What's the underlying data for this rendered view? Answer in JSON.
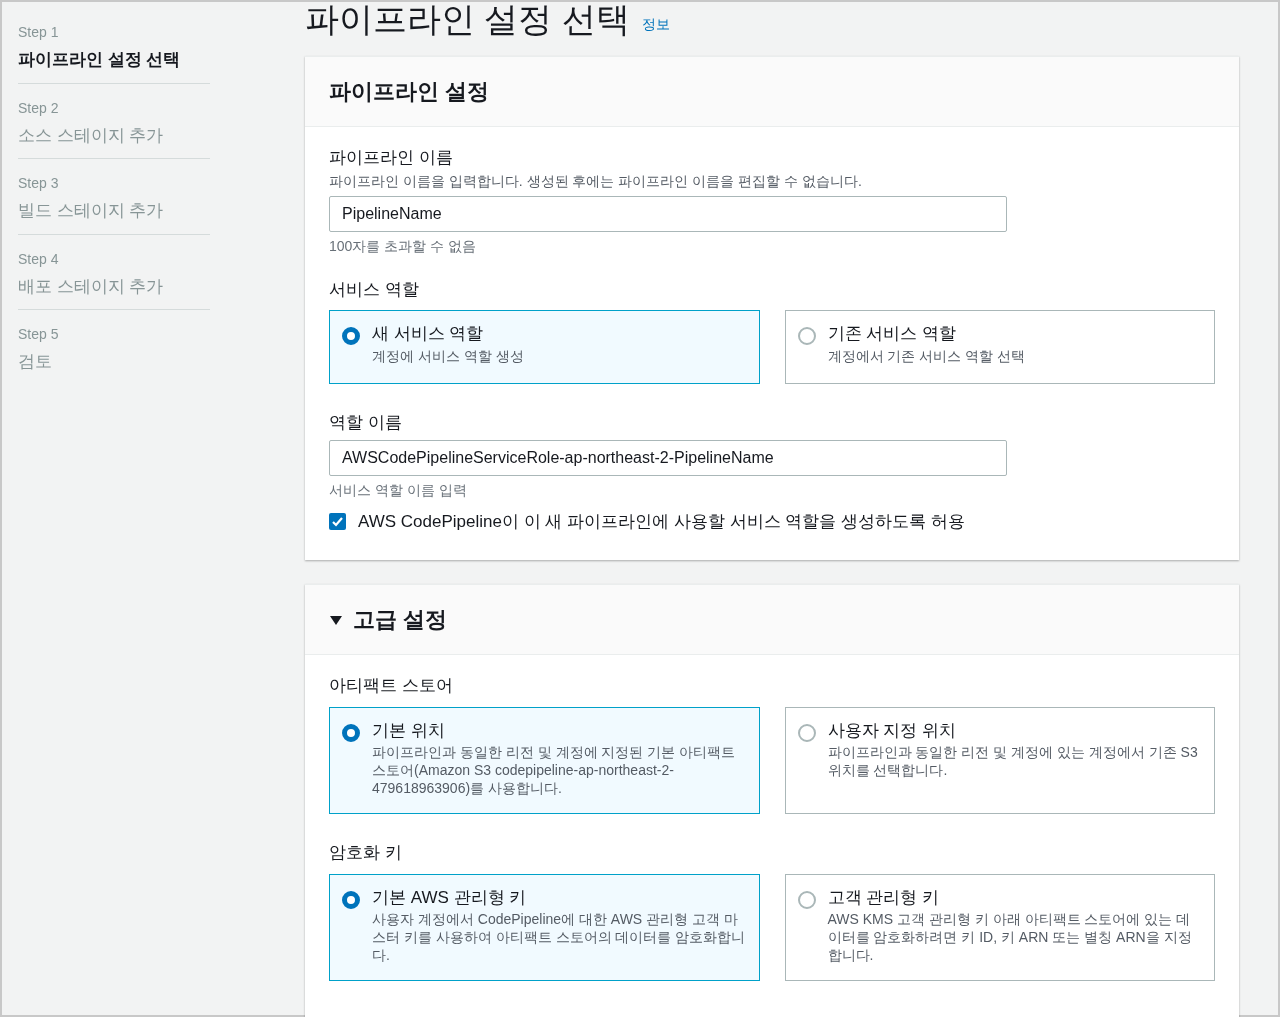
{
  "steps": [
    {
      "step": "Step 1",
      "label": "파이프라인 설정 선택",
      "selected": true
    },
    {
      "step": "Step 2",
      "label": "소스 스테이지 추가",
      "selected": false
    },
    {
      "step": "Step 3",
      "label": "빌드 스테이지 추가",
      "selected": false
    },
    {
      "step": "Step 4",
      "label": "배포 스테이지 추가",
      "selected": false
    },
    {
      "step": "Step 5",
      "label": "검토",
      "selected": false
    }
  ],
  "page": {
    "title": "파이프라인 설정 선택",
    "info_link": "정보"
  },
  "sections": [
    {
      "title": "파이프라인 설정",
      "fields": [
        {
          "kind": "text_input",
          "label": "파이프라인 이름",
          "description": "파이프라인 이름을 입력합니다. 생성된 후에는 파이프라인 이름을 편집할 수 없습니다.",
          "value": "PipelineName",
          "hint": "100자를 초과할 수 없음"
        },
        {
          "kind": "radio_group",
          "label": "서비스 역할",
          "options": [
            {
              "title": "새 서비스 역할",
              "description": "계정에 서비스 역할 생성",
              "selected": true
            },
            {
              "title": "기존 서비스 역할",
              "description": "계정에서 기존 서비스 역할 선택",
              "selected": false
            }
          ]
        },
        {
          "kind": "text_input",
          "label": "역할 이름",
          "value": "AWSCodePipelineServiceRole-ap-northeast-2-PipelineName",
          "hint": "서비스 역할 이름 입력"
        },
        {
          "kind": "checkbox",
          "label": "AWS CodePipeline이 이 새 파이프라인에 사용할 서비스 역할을 생성하도록 허용",
          "checked": true
        }
      ]
    },
    {
      "title": "고급 설정",
      "expanded": true,
      "fields": [
        {
          "kind": "radio_group",
          "label": "아티팩트 스토어",
          "options": [
            {
              "title": "기본 위치",
              "description": "파이프라인과 동일한 리전 및 계정에 지정된 기본 아티팩트 스토어(Amazon S3 codepipeline-ap-northeast-2-479618963906)를 사용합니다.",
              "selected": true
            },
            {
              "title": "사용자 지정 위치",
              "description": "파이프라인과 동일한 리전 및 계정에 있는 계정에서 기존 S3 위치를 선택합니다.",
              "selected": false
            }
          ]
        },
        {
          "kind": "radio_group",
          "label": "암호화 키",
          "options": [
            {
              "title": "기본 AWS 관리형 키",
              "description": "사용자 계정에서 CodePipeline에 대한 AWS 관리형 고객 마스터 키를 사용하여 아티팩트 스토어의 데이터를 암호화합니다.",
              "selected": true
            },
            {
              "title": "고객 관리형 키",
              "description": "AWS KMS 고객 관리형 키 아래 아티팩트 스토어에 있는 데이터를 암호화하려면 키 ID, 키 ARN 또는 별칭 ARN을 지정합니다.",
              "selected": false
            }
          ]
        }
      ]
    }
  ]
}
